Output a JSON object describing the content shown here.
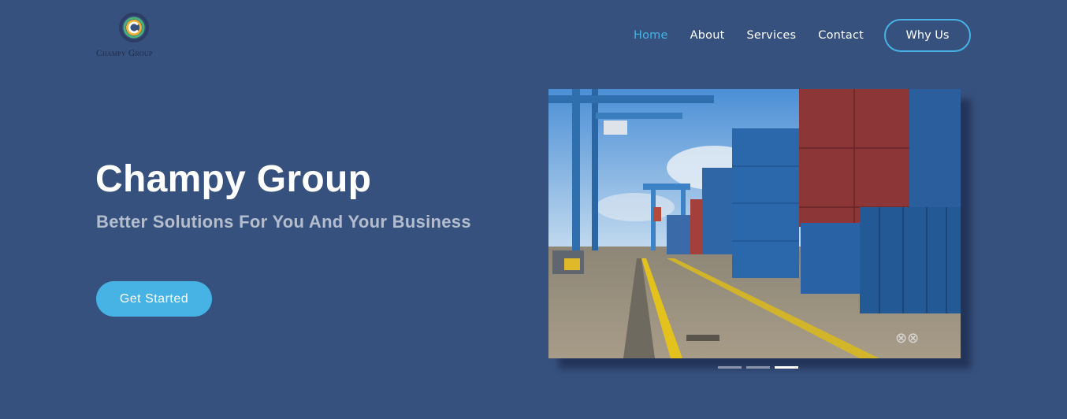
{
  "brand": {
    "name": "Champy Group",
    "logo_icon": "c-ring-logo-icon"
  },
  "nav": {
    "items": [
      {
        "label": "Home",
        "active": true
      },
      {
        "label": "About",
        "active": false
      },
      {
        "label": "Services",
        "active": false
      },
      {
        "label": "Contact",
        "active": false
      }
    ],
    "cta_label": "Why Us"
  },
  "hero": {
    "title": "Champy Group",
    "subtitle": "Better Solutions For You And Your Business",
    "button_label": "Get Started",
    "slider": {
      "slide_count": 3,
      "active_index": 2
    }
  },
  "colors": {
    "background": "#37517e",
    "accent": "#47b2e4"
  }
}
